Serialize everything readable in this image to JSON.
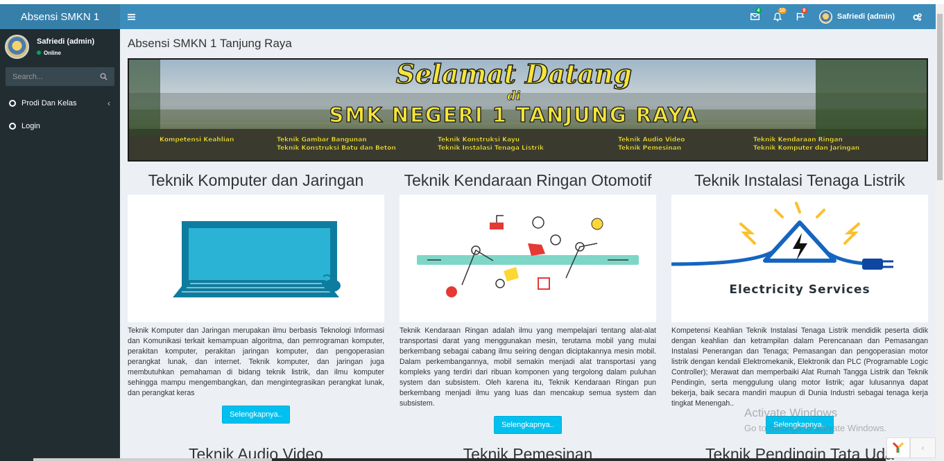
{
  "app": {
    "logo": "Absensi SMKN 1"
  },
  "header": {
    "messages_badge": "4",
    "notifications_badge": "10",
    "tasks_badge": "9",
    "user_name": "Safriedi (admin)"
  },
  "sidebar": {
    "user_name": "Safriedi (admin)",
    "status": "Online",
    "search_placeholder": "Search...",
    "items": [
      {
        "label": "Prodi Dan Kelas"
      },
      {
        "label": "Login"
      }
    ]
  },
  "main": {
    "page_title": "Absensi SMKN 1 Tanjung Raya",
    "banner": {
      "line1": "Selamat Datang",
      "line2": "di",
      "line3": "SMK NEGERI 1 TANJUNG RAYA",
      "label": "Kompetensi Keahlian",
      "programs_a": [
        "Teknik Gambar Bangunan",
        "Teknik Konstruksi Batu dan Beton"
      ],
      "programs_b": [
        "Teknik Konstruksi Kayu",
        "Teknik Instalasi Tenaga Listrik"
      ],
      "programs_c": [
        "Teknik Audio Video",
        "Teknik Pemesinan"
      ],
      "programs_d": [
        "Teknik Kendaraan Ringan",
        "Teknik Komputer dan Jaringan"
      ]
    },
    "cards": [
      {
        "title": "Teknik Komputer dan Jaringan",
        "text": "Teknik Komputer dan Jaringan merupakan ilmu berbasis Teknologi Informasi dan Komunikasi terkait kemampuan algoritma, dan pemrograman komputer, perakitan komputer, perakitan jaringan komputer, dan pengoperasian perangkat lunak, dan internet. Teknik komputer, dan jaringan juga membutuhkan pemahaman di bidang teknik listrik, dan ilmu komputer sehingga mampu mengembangkan, dan mengintegrasikan perangkat lunak, dan perangkat keras",
        "button": "Selengkapnya.."
      },
      {
        "title": "Teknik Kendaraan Ringan Otomotif",
        "text": "Teknik Kendaraan Ringan adalah ilmu yang mempelajari tentang alat-alat transportasi darat yang menggunakan mesin, terutama mobil yang mulai berkembang sebagai cabang ilmu seiring dengan diciptakannya mesin mobil. Dalam perkembangannya, mobil semakin menjadi alat transportasi yang kompleks yang terdiri dari ribuan komponen yang tergolong dalam puluhan system dan subsistem. Oleh karena itu, Teknik Kendaraan Ringan pun berkembang menjadi ilmu yang luas dan mencakup semua system dan subsistem.",
        "button": "Selengkapnya.."
      },
      {
        "title": "Teknik Instalasi Tenaga Listrik",
        "text": "Kompetensi Keahlian Teknik Instalasi Tenaga Listrik mendidik peserta didik dengan keahlian dan ketrampilan dalam Perencanaan dan Pemasangan Instalasi Penerangan dan Tenaga; Pemasangan dan pengoperasian motor listrik dengan kendali Elektromekanik, Elektronik dan PLC (Programable Logic Controller); Merawat dan memperbaiki Alat Rumah Tangga Listrik dan Teknik Pendingin, serta menggulung ulang motor listrik; agar lulusannya dapat bekerja, baik secara mandiri maupun di Dunia Industri sebagai tenaga kerja tingkat Menengah..",
        "button": "Selengkapnya..",
        "image_caption": "Electricity Services"
      }
    ],
    "next_titles": [
      "Teknik Audio Video",
      "Teknik Pemesinan",
      "Teknik Pendingin Tata Uda"
    ]
  },
  "watermark": {
    "line1": "Activate Windows",
    "line2": "Go to Settings to activate Windows."
  },
  "colors": {
    "header": "#3c8dbc",
    "logo_bg": "#367fa9",
    "sidebar": "#222d32",
    "button": "#00c0ef"
  }
}
